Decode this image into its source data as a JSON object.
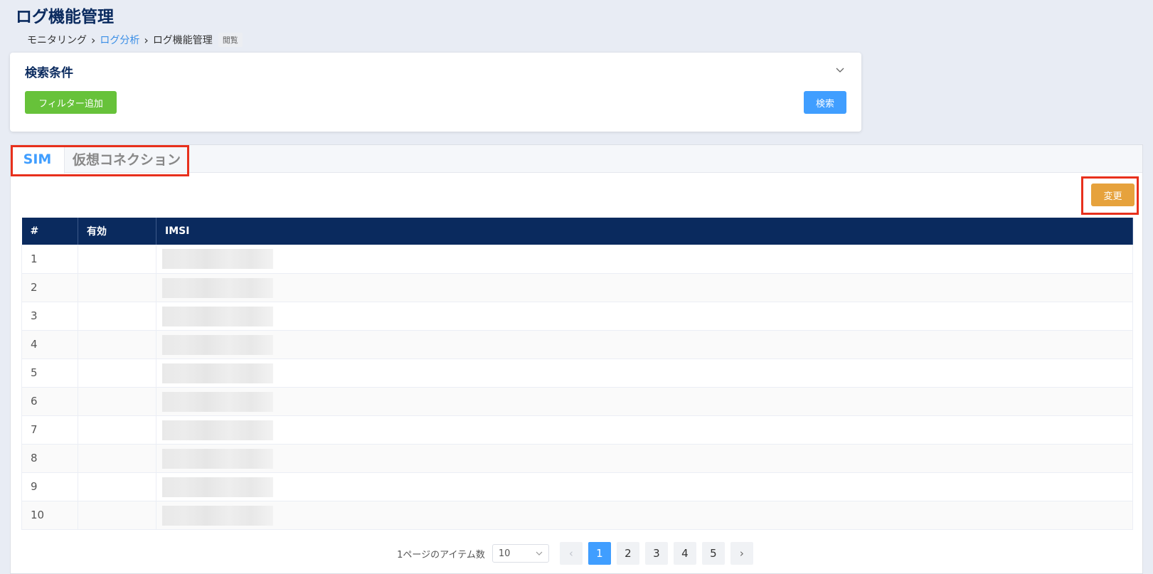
{
  "page": {
    "title": "ログ機能管理"
  },
  "breadcrumb": {
    "items": [
      "モニタリング",
      "ログ分析",
      "ログ機能管理"
    ],
    "badge": "閲覧"
  },
  "search": {
    "title": "検索条件",
    "filter_button": "フィルター追加",
    "search_button": "検索"
  },
  "tabs": [
    {
      "label": "SIM",
      "active": true
    },
    {
      "label": "仮想コネクション",
      "active": false
    }
  ],
  "toolbar": {
    "change_button": "変更"
  },
  "table": {
    "headers": [
      "#",
      "有効",
      "IMSI"
    ],
    "rows": [
      {
        "num": "1",
        "valid": "",
        "imsi": ""
      },
      {
        "num": "2",
        "valid": "",
        "imsi": ""
      },
      {
        "num": "3",
        "valid": "",
        "imsi": ""
      },
      {
        "num": "4",
        "valid": "",
        "imsi": ""
      },
      {
        "num": "5",
        "valid": "",
        "imsi": ""
      },
      {
        "num": "6",
        "valid": "",
        "imsi": ""
      },
      {
        "num": "7",
        "valid": "",
        "imsi": ""
      },
      {
        "num": "8",
        "valid": "",
        "imsi": ""
      },
      {
        "num": "9",
        "valid": "",
        "imsi": ""
      },
      {
        "num": "10",
        "valid": "",
        "imsi": ""
      }
    ]
  },
  "pagination": {
    "page_size_label": "1ページのアイテム数",
    "page_size": "10",
    "pages": [
      "1",
      "2",
      "3",
      "4",
      "5"
    ],
    "current_page": "1",
    "prev": "‹",
    "next": "›"
  },
  "colors": {
    "primary": "#409eff",
    "success": "#67c23a",
    "warning": "#e6a23c",
    "header_navy": "#0a2a5e",
    "highlight": "#e8301c"
  }
}
